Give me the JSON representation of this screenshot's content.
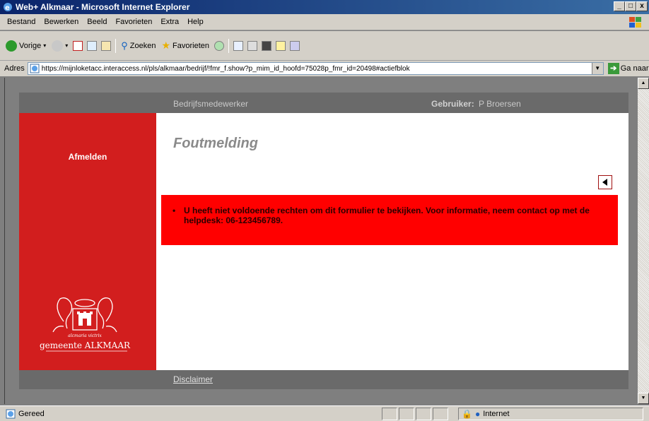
{
  "window": {
    "title": "Web+ Alkmaar - Microsoft Internet Explorer",
    "controls": [
      "_",
      "□",
      "x"
    ]
  },
  "menu": {
    "items": [
      "Bestand",
      "Bewerken",
      "Beeld",
      "Favorieten",
      "Extra",
      "Help"
    ]
  },
  "toolbar": {
    "back_label": "Vorige",
    "search_label": "Zoeken",
    "favorites_label": "Favorieten"
  },
  "address": {
    "label": "Adres",
    "url": "https://mijnloketacc.interaccess.nl/pls/alkmaar/bedrijf/!fmr_f.show?p_mim_id_hoofd=75028p_fmr_id=20498#actiefblok",
    "go_label": "Ga naar"
  },
  "page": {
    "header": {
      "role": "Bedrijfsmedewerker",
      "user_label": "Gebruiker:",
      "user_name": "P Broersen"
    },
    "sidebar": {
      "logout_label": "Afmelden",
      "logo_motto": "alcmaria victrix",
      "logo_text": "gemeente ALKMAAR"
    },
    "main": {
      "heading": "Foutmelding",
      "error_message": "U heeft niet voldoende rechten om dit formulier te bekijken. Voor informatie, neem contact op met de helpdesk: 06-123456789."
    },
    "footer": {
      "disclaimer_label": "Disclaimer"
    }
  },
  "status": {
    "text": "Gereed",
    "zone": "Internet"
  },
  "colors": {
    "sidebar_red": "#d21e1e",
    "error_red": "#ff0000",
    "strip_gray": "#6a6a6a"
  }
}
